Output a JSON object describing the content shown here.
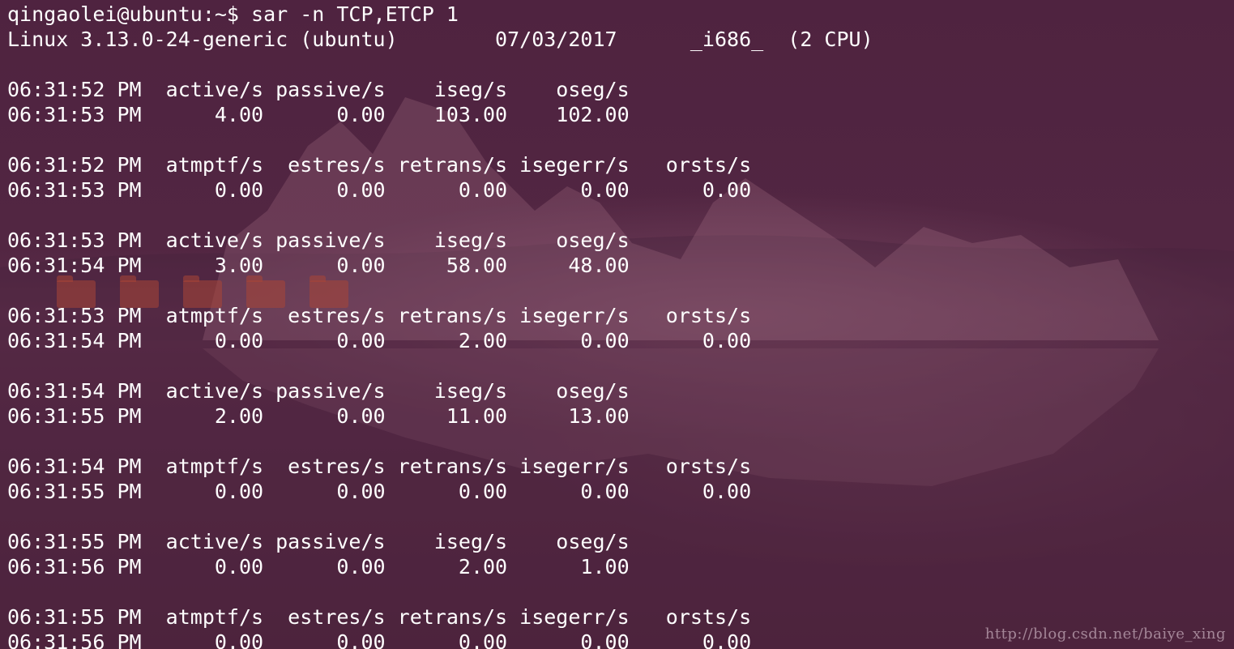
{
  "terminal": {
    "lines": [
      "qingaolei@ubuntu:~$ sar -n TCP,ETCP 1",
      "Linux 3.13.0-24-generic (ubuntu)        07/03/2017      _i686_  (2 CPU)",
      "",
      "06:31:52 PM  active/s passive/s    iseg/s    oseg/s",
      "06:31:53 PM      4.00      0.00    103.00    102.00",
      "",
      "06:31:52 PM  atmptf/s  estres/s retrans/s isegerr/s   orsts/s",
      "06:31:53 PM      0.00      0.00      0.00      0.00      0.00",
      "",
      "06:31:53 PM  active/s passive/s    iseg/s    oseg/s",
      "06:31:54 PM      3.00      0.00     58.00     48.00",
      "",
      "06:31:53 PM  atmptf/s  estres/s retrans/s isegerr/s   orsts/s",
      "06:31:54 PM      0.00      0.00      2.00      0.00      0.00",
      "",
      "06:31:54 PM  active/s passive/s    iseg/s    oseg/s",
      "06:31:55 PM      2.00      0.00     11.00     13.00",
      "",
      "06:31:54 PM  atmptf/s  estres/s retrans/s isegerr/s   orsts/s",
      "06:31:55 PM      0.00      0.00      0.00      0.00      0.00",
      "",
      "06:31:55 PM  active/s passive/s    iseg/s    oseg/s",
      "06:31:56 PM      0.00      0.00      2.00      1.00",
      "",
      "06:31:55 PM  atmptf/s  estres/s retrans/s isegerr/s   orsts/s",
      "06:31:56 PM      0.00      0.00      0.00      0.00      0.00"
    ]
  },
  "watermark": "http://blog.csdn.net/baiye_xing",
  "colors": {
    "background": "#4f2340",
    "text": "#ffffff"
  }
}
